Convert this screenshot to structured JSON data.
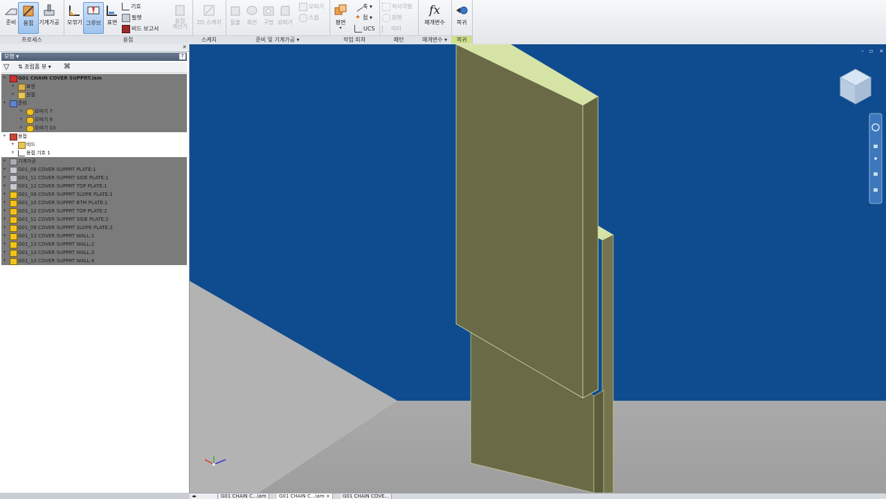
{
  "ribbon": {
    "panels": {
      "process": "프로세스",
      "weld": "용접",
      "sketch": "스케치",
      "prep": "준비 및 기계가공",
      "work": "작업 피쳐",
      "pattern": "패턴",
      "params": "매개변수",
      "return": "복귀"
    },
    "buttons": {
      "prep": "준비",
      "weld": "용접",
      "machining": "기계가공",
      "fillet": "모깎기",
      "groove": "그루브",
      "cosmetic": "표면",
      "symbol": "기호",
      "fill": "필렛",
      "bead_report": "비드 보고서",
      "weld_calc_1": "용접",
      "weld_calc_2": "계산기",
      "sketch2d": "2D 스케치",
      "extrude": "돌출",
      "revolve": "회전",
      "hole": "구멍",
      "chamfer_fillet": "모따기",
      "chamfer": "모따기",
      "sweep": "스윕",
      "plane": "평면",
      "axis": "축",
      "point": "점",
      "ucs": "UCS",
      "rect_pattern": "직사각형",
      "circ_pattern": "원형",
      "mirror": "미러",
      "parameters": "매개변수",
      "return": "복귀"
    }
  },
  "browser": {
    "title": "모형",
    "toolbar_view": "조립품 뷰",
    "items": [
      {
        "label": "G01 CHAIN COVER SUPPRT.iam",
        "level": 0,
        "style": "grey",
        "icon": "assembly-icon",
        "bold": true
      },
      {
        "label": "표현",
        "level": 1,
        "style": "grey",
        "icon": "representations-icon"
      },
      {
        "label": "원점",
        "level": 1,
        "style": "grey",
        "icon": "folder-icon"
      },
      {
        "label": "준비",
        "level": 0,
        "style": "grey",
        "icon": "preparation-icon"
      },
      {
        "label": "모따기 7",
        "level": 2,
        "style": "grey",
        "icon": "chamfer-feature-icon"
      },
      {
        "label": "모따기 9",
        "level": 2,
        "style": "grey",
        "icon": "chamfer-feature-icon"
      },
      {
        "label": "모따기 10",
        "level": 2,
        "style": "grey",
        "icon": "chamfer-feature-icon"
      },
      {
        "label": "용접",
        "level": 0,
        "style": "white",
        "icon": "weld-icon"
      },
      {
        "label": "비드",
        "level": 1,
        "style": "white",
        "icon": "folder-icon"
      },
      {
        "label": "용접 기호 1",
        "level": 1,
        "style": "white",
        "icon": "weld-symbol-icon"
      },
      {
        "label": "기계가공",
        "level": 0,
        "style": "grey",
        "icon": "machining-icon"
      },
      {
        "label": "G01_08 COVER SUPPRT PLATE:1",
        "level": 0,
        "style": "grey",
        "icon": "part-icon"
      },
      {
        "label": "G01_11 COVER SUPPRT SIDE PLATE:1",
        "level": 0,
        "style": "grey",
        "icon": "part-icon"
      },
      {
        "label": "G01_12 COVER SUPPRT TOP PLATE:1",
        "level": 0,
        "style": "grey",
        "icon": "part-icon"
      },
      {
        "label": "G01_09 COVER SUPPRT SLOPE PLATE:1",
        "level": 0,
        "style": "grey",
        "icon": "part-yellow-icon"
      },
      {
        "label": "G01_10 COVER SUPPRT BTM PLATE:1",
        "level": 0,
        "style": "grey",
        "icon": "part-yellow-icon"
      },
      {
        "label": "G01_12 COVER SUPPRT TOP PLATE:2",
        "level": 0,
        "style": "grey",
        "icon": "part-yellow-icon"
      },
      {
        "label": "G01_11 COVER SUPPRT SIDE PLATE:2",
        "level": 0,
        "style": "grey",
        "icon": "part-yellow-icon"
      },
      {
        "label": "G01_09 COVER SUPPRT SLOPE PLATE:2",
        "level": 0,
        "style": "grey",
        "icon": "part-yellow-icon"
      },
      {
        "label": "G01_13 COVER SUPPRT WALL:1",
        "level": 0,
        "style": "grey",
        "icon": "part-yellow-icon"
      },
      {
        "label": "G01_13 COVER SUPPRT WALL:2",
        "level": 0,
        "style": "grey",
        "icon": "part-yellow-icon"
      },
      {
        "label": "G01_13 COVER SUPPRT WALL:3",
        "level": 0,
        "style": "grey",
        "icon": "part-yellow-icon"
      },
      {
        "label": "G01_13 COVER SUPPRT WALL:4",
        "level": 0,
        "style": "grey",
        "icon": "part-yellow-icon"
      }
    ]
  },
  "document_tabs": [
    "G01 CHAIN C...iam",
    "G01 CHAIN C...iam",
    "G01 CHAIN COVE..."
  ],
  "colors": {
    "background_blue": "#0f4b8f",
    "floor_grey": "#a6a6a6",
    "part_face": "#6b6a47",
    "part_top": "#d6e3a6",
    "ribbon_active": "#9dc3ef"
  }
}
